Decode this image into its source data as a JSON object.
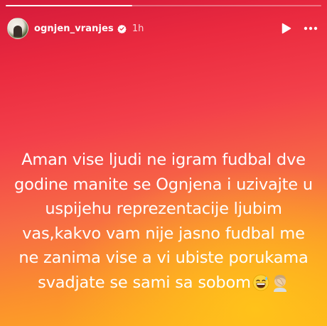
{
  "story": {
    "progress": 0.4,
    "user": {
      "username": "ognjen_vranjes",
      "verified": true,
      "time": "1h"
    },
    "icons": {
      "play": "play-icon",
      "more": "more-icon",
      "verified": "verified-badge-icon"
    },
    "caption_lines": [
      "Aman vise ljudi ne igram fudbal dve",
      "godine manite se Ognjena i uzivajte u",
      "uspijehu reprezentacije ljubim",
      "vas,kakvo vam nije jasno fudbal me",
      "ne zanima vise a vi ubiste porukama",
      "svadjate se sami sa sobom"
    ],
    "caption_emojis": [
      "grinning-sweat-emoji",
      "facepalm-emoji"
    ],
    "colors": {
      "gradient_top": "#d41a3a",
      "gradient_mid": "#f3404a",
      "gradient_bottom": "#ffb21c",
      "text": "#ffffff"
    }
  }
}
